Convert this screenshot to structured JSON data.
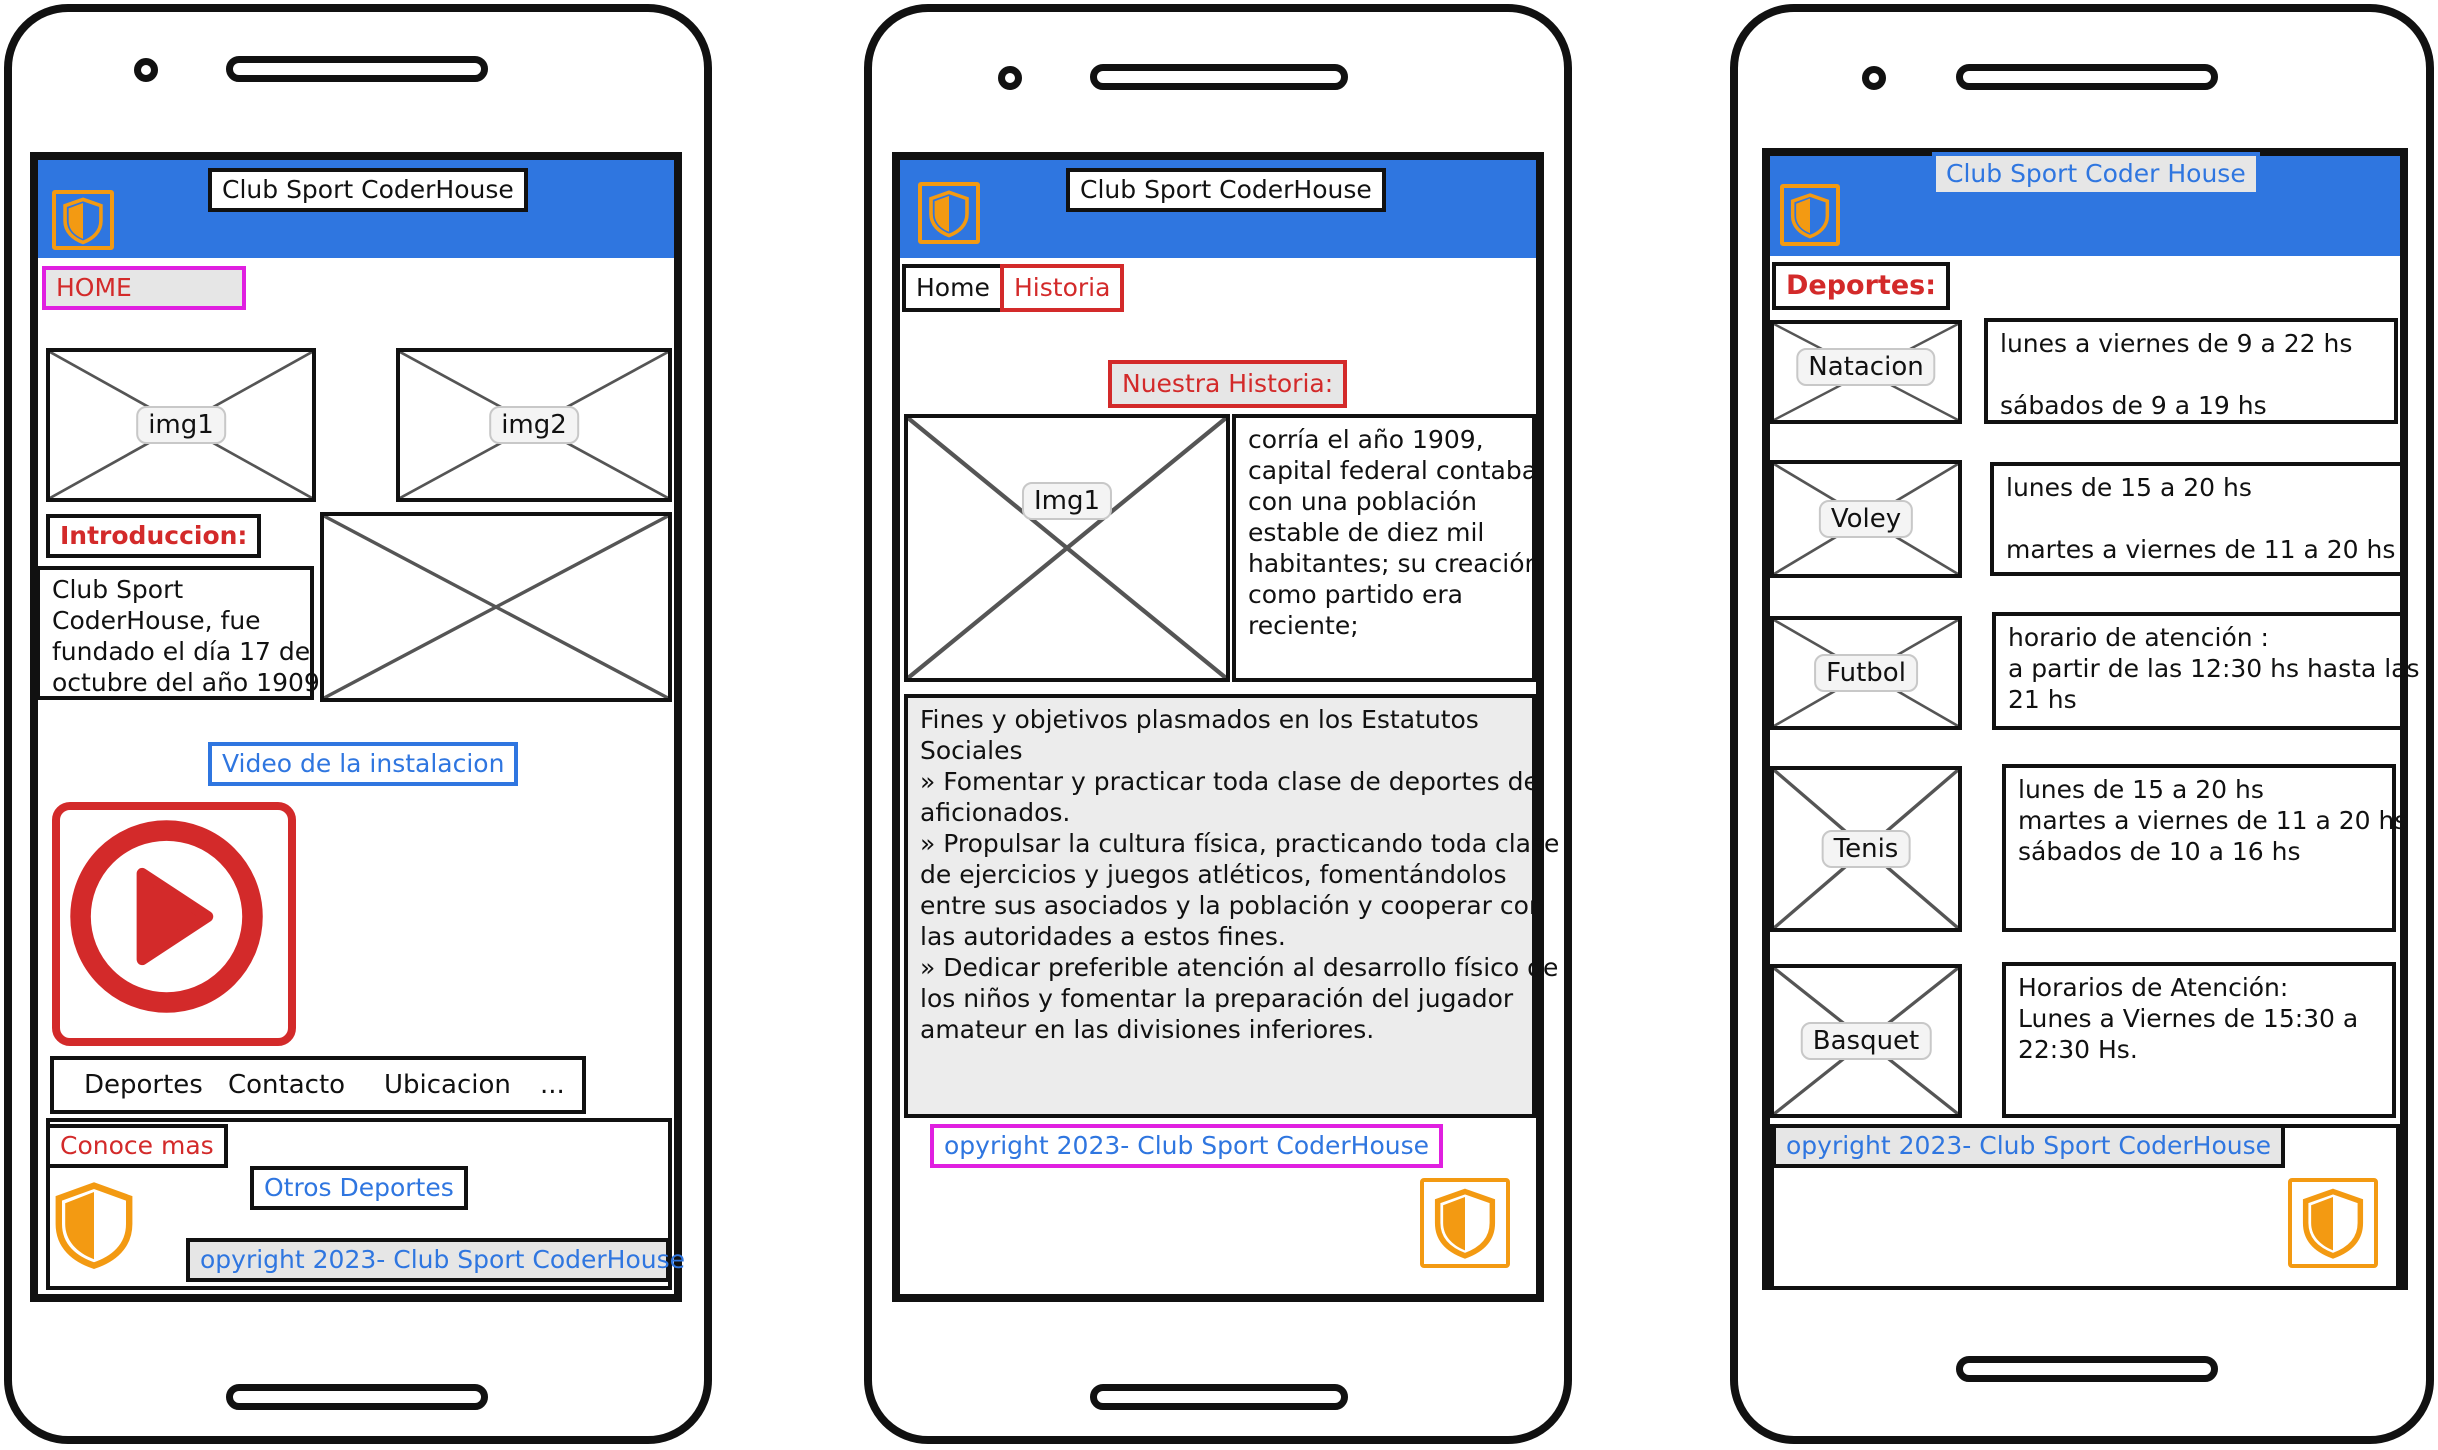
{
  "colors": {
    "header_blue": "#2f76e0",
    "accent_red": "#d32a2a",
    "shield_orange": "#f39a12",
    "highlight_pink": "#e01fe0",
    "stroke": "#111111"
  },
  "icons": [
    "shield-icon",
    "play-icon",
    "placeholder-image"
  ],
  "screen1": {
    "title": "Club Sport CoderHouse",
    "home": "HOME",
    "img1": "img1",
    "img2": "img2",
    "intro_title": "Introduccion:",
    "intro_lines": [
      "Club Sport",
      "CoderHouse, fue",
      "fundado el día 17 de",
      "octubre del año 1909."
    ],
    "video_label": "Video de la instalacion",
    "nav": [
      "Deportes",
      "Contacto",
      "Ubicacion",
      "..."
    ],
    "more": "Conoce mas",
    "other_sports": "Otros Deportes",
    "copyright": "opyright 2023- Club Sport CoderHouse"
  },
  "screen2": {
    "title": "Club Sport CoderHouse",
    "tabs": [
      "Home",
      "Historia"
    ],
    "section_title": "Nuestra Historia:",
    "img": "Img1",
    "story_lines": [
      "corría el año 1909,",
      "capital federal contaba",
      "con una población",
      "estable de diez mil",
      "habitantes; su creación",
      "como partido era",
      "reciente;"
    ],
    "goals_lines": [
      "Fines y objetivos plasmados en los Estatutos",
      "Sociales",
      "» Fomentar y practicar toda clase de deportes de",
      "aficionados.",
      "» Propulsar la cultura física, practicando toda clase",
      "de ejercicios y juegos atléticos, fomentándolos",
      "entre sus asociados y la población y cooperar con",
      "las autoridades a estos fines.",
      "» Dedicar preferible atención al desarrollo físico de",
      "los niños y fomentar la preparación del jugador",
      "amateur en las divisiones inferiores."
    ],
    "copyright": "opyright 2023- Club Sport CoderHouse"
  },
  "screen3": {
    "title": "Club Sport Coder  House",
    "section_title": "Deportes:",
    "sports": [
      {
        "name": "Natacion",
        "lines": [
          "lunes a viernes de 9 a 22 hs",
          "",
          "sábados de 9 a 19 hs"
        ]
      },
      {
        "name": "Voley",
        "lines": [
          "lunes de 15 a 20 hs",
          "",
          "martes a viernes de 11 a 20 hs"
        ]
      },
      {
        "name": "Futbol",
        "lines": [
          "horario de atención :",
          "a partir de las 12:30 hs hasta las",
          "21 hs"
        ]
      },
      {
        "name": "Tenis",
        "lines": [
          "lunes de 15 a 20 hs",
          "martes a viernes de 11 a 20 hs",
          "sábados de 10 a 16 hs"
        ]
      },
      {
        "name": "Basquet",
        "lines": [
          "Horarios de Atención:",
          "Lunes a Viernes de 15:30 a",
          "22:30 Hs."
        ]
      }
    ],
    "copyright": "opyright 2023- Club Sport CoderHouse"
  }
}
